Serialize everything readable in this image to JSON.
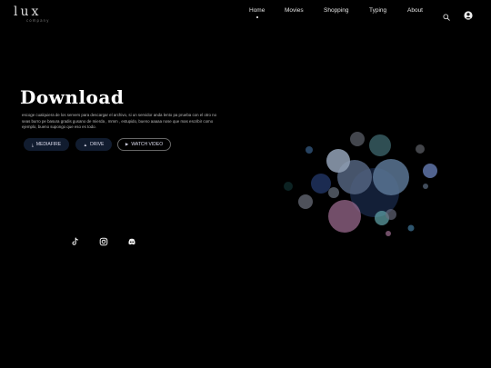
{
  "logo": {
    "main": "lux",
    "sub": "company"
  },
  "nav": {
    "items": [
      {
        "label": "Home",
        "active": true
      },
      {
        "label": "Movies",
        "active": false
      },
      {
        "label": "Shopping",
        "active": false
      },
      {
        "label": "Typing",
        "active": false
      },
      {
        "label": "About",
        "active": false
      }
    ],
    "icons": [
      "search-icon",
      "user-icon"
    ]
  },
  "hero": {
    "title": "Download",
    "description": "escoge cualquiera de los servers para descargar el archivo, si un servidor anda lento pa prueba con el otro no seas burro pe basura gradis gusano de mierda , mmm , estupido, bueno aaaaa nose que mas escribir como ejemplo, bueno supongo que eso es todo."
  },
  "buttons": [
    {
      "label": "MEDIAFIRE",
      "icon": "download-icon"
    },
    {
      "label": "DRIVE",
      "icon": "drive-icon"
    },
    {
      "label": "WATCH VIDEO",
      "icon": "play-icon"
    }
  ],
  "social": [
    "tiktok-icon",
    "instagram-icon",
    "discord-icon"
  ],
  "colors": {
    "background": "#000000",
    "button_fill": "#111c2f"
  }
}
